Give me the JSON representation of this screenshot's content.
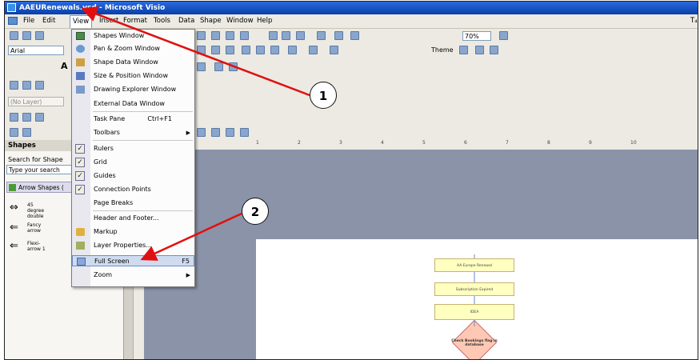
{
  "window": {
    "title": "AAEURenewals.vsd - Microsoft Visio",
    "right_text": "T₄"
  },
  "menubar": {
    "items": [
      {
        "label": "File"
      },
      {
        "label": "Edit"
      },
      {
        "label": "View"
      },
      {
        "label": "Insert"
      },
      {
        "label": "Format"
      },
      {
        "label": "Tools"
      },
      {
        "label": "Data"
      },
      {
        "label": "Shape"
      },
      {
        "label": "Window"
      },
      {
        "label": "Help"
      }
    ],
    "active": "View"
  },
  "toolbars": {
    "font": "Arial",
    "zoom": "70%",
    "theme_label": "Theme",
    "layer": "(No Layer)",
    "bold_initial": "A"
  },
  "view_menu": {
    "items": [
      {
        "label": "Shapes Window",
        "icon": "shapes-window-icon"
      },
      {
        "label": "Pan & Zoom Window",
        "icon": "pan-zoom-icon"
      },
      {
        "label": "Shape Data Window",
        "icon": "shape-data-icon"
      },
      {
        "label": "Size & Position Window",
        "icon": "size-position-icon"
      },
      {
        "label": "Drawing Explorer Window",
        "icon": "drawing-explorer-icon"
      },
      {
        "label": "External Data Window"
      },
      {
        "label": "Task Pane",
        "shortcut": "Ctrl+F1"
      },
      {
        "label": "Toolbars",
        "submenu": true
      },
      {
        "label": "Rulers",
        "checked": true
      },
      {
        "label": "Grid",
        "checked": true
      },
      {
        "label": "Guides",
        "checked": true
      },
      {
        "label": "Connection Points",
        "checked": true
      },
      {
        "label": "Page Breaks"
      },
      {
        "label": "Header and Footer..."
      },
      {
        "label": "Markup",
        "icon": "markup-icon"
      },
      {
        "label": "Layer Properties...",
        "icon": "layer-properties-icon"
      },
      {
        "label": "Full Screen",
        "shortcut": "F5",
        "highlighted": true,
        "icon": "full-screen-icon"
      },
      {
        "label": "Zoom",
        "submenu": true
      }
    ]
  },
  "shapes_pane": {
    "title": "Shapes",
    "search_label": "Search for Shape",
    "search_placeholder": "Type your search",
    "stencil": "Arrow Shapes (",
    "shapes": [
      {
        "label": "45 degree double"
      },
      {
        "label": "Fancy arrow"
      },
      {
        "label": "Flexi-arrow 1"
      }
    ]
  },
  "ruler_ticks": [
    "1",
    "2",
    "3",
    "4",
    "5",
    "6",
    "7",
    "8",
    "9",
    "10"
  ],
  "flowchart": {
    "boxes": [
      "AA Europe Renewal",
      "Subscription Expired",
      "IDEA"
    ],
    "decision": "Check Bookings flag in database"
  },
  "callouts": [
    "1",
    "2"
  ],
  "colors": {
    "arrow": "#e01010",
    "titlebar": "#0a3ea8",
    "highlight": "#cfdcf0"
  }
}
